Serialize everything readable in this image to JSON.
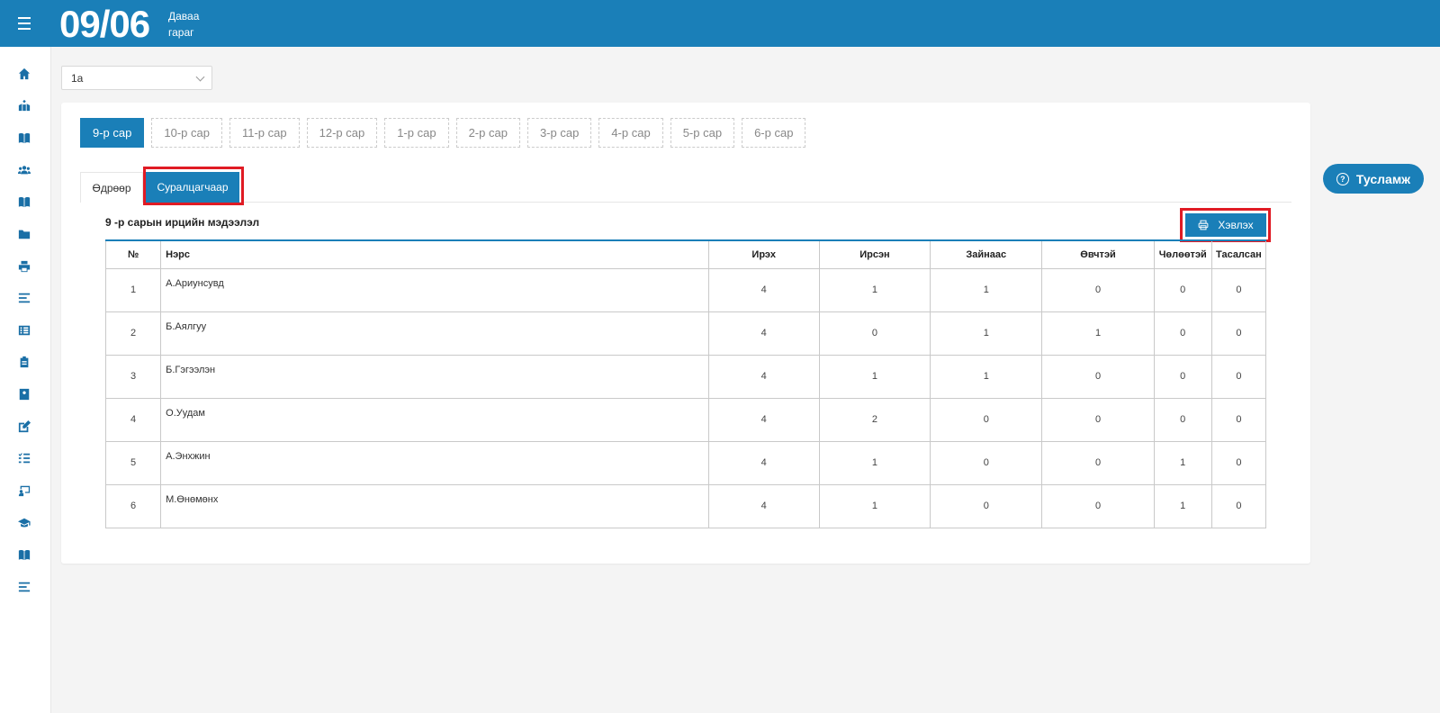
{
  "header": {
    "date": "09/06",
    "weekday_line1": "Даваа",
    "weekday_line2": "гараг"
  },
  "sidebar": {
    "icons": [
      "home-icon",
      "school-icon",
      "book-icon",
      "users-icon",
      "book-open-icon",
      "folder-icon",
      "print-icon",
      "list-icon",
      "list-alt-icon",
      "clipboard-icon",
      "id-card-icon",
      "edit-icon",
      "task-list-icon",
      "teacher-icon",
      "graduation-cap-icon",
      "book-icon-2",
      "align-left-icon"
    ]
  },
  "class_select": {
    "value": "1а"
  },
  "months": [
    "9-р сар",
    "10-р сар",
    "11-р сар",
    "12-р сар",
    "1-р сар",
    "2-р сар",
    "3-р сар",
    "4-р сар",
    "5-р сар",
    "6-р сар"
  ],
  "active_month_index": 0,
  "subtabs": {
    "by_day": "Өдрөөр",
    "by_student": "Суралцагчаар"
  },
  "section": {
    "title": "9 -р сарын ирцийн мэдээлэл",
    "print_label": "Хэвлэх"
  },
  "table": {
    "headers": [
      "№",
      "Нэрс",
      "Ирэх",
      "Ирсэн",
      "Зайнаас",
      "Өвчтэй",
      "Чөлөөтэй",
      "Тасалсан"
    ],
    "rows": [
      [
        "1",
        "А.Ариунсувд",
        "4",
        "1",
        "1",
        "0",
        "0",
        "0"
      ],
      [
        "2",
        "Б.Аялгуу",
        "4",
        "0",
        "1",
        "1",
        "0",
        "0"
      ],
      [
        "3",
        "Б.Гэгээлэн",
        "4",
        "1",
        "1",
        "0",
        "0",
        "0"
      ],
      [
        "4",
        "О.Уудам",
        "4",
        "2",
        "0",
        "0",
        "0",
        "0"
      ],
      [
        "5",
        "А.Энхжин",
        "4",
        "1",
        "0",
        "0",
        "1",
        "0"
      ],
      [
        "6",
        "М.Өнөмөнх",
        "4",
        "1",
        "0",
        "0",
        "1",
        "0"
      ]
    ]
  },
  "help": {
    "label": "Тусламж"
  },
  "colors": {
    "primary": "#1a7fb8",
    "highlight": "#e01b24"
  }
}
